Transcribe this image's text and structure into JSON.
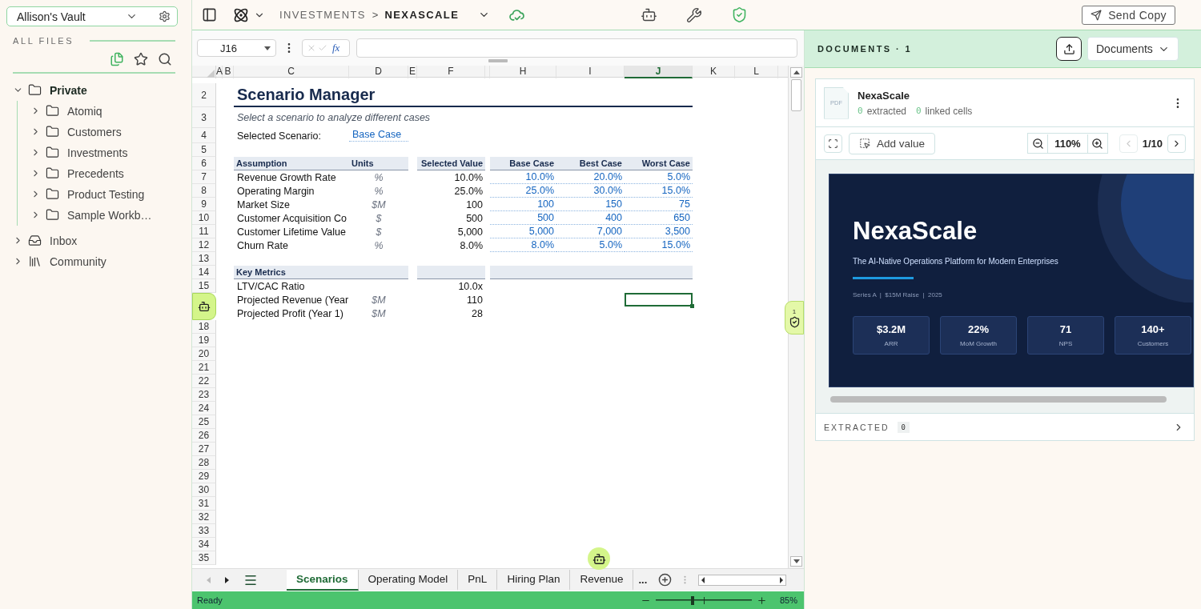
{
  "sidebar": {
    "vault": "Allison's Vault",
    "section_label": "ALL FILES",
    "tree": [
      {
        "label": "Private",
        "kind": "folder",
        "expanded": true,
        "children": [
          {
            "label": "Atomiq",
            "kind": "folder",
            "expanded": false
          },
          {
            "label": "Customers",
            "kind": "folder",
            "expanded": false
          },
          {
            "label": "Investments",
            "kind": "folder",
            "expanded": false
          },
          {
            "label": "Precedents",
            "kind": "folder",
            "expanded": false
          },
          {
            "label": "Product Testing",
            "kind": "folder",
            "expanded": false
          },
          {
            "label": "Sample Workb…",
            "kind": "folder",
            "expanded": false
          }
        ]
      },
      {
        "label": "Inbox",
        "kind": "inbox",
        "expanded": false
      },
      {
        "label": "Community",
        "kind": "library",
        "expanded": false
      }
    ]
  },
  "toolbar": {
    "breadcrumb": [
      {
        "label": "INVESTMENTS",
        "current": false
      },
      {
        "label": "NEXASCALE",
        "current": true
      }
    ],
    "separator": ">",
    "send_button": "Send Copy"
  },
  "sheet": {
    "name_box": "J16",
    "fx": "fx",
    "columns": [
      {
        "label": "A",
        "selected": false
      },
      {
        "label": "B",
        "selected": false
      },
      {
        "label": "C",
        "selected": false
      },
      {
        "label": "D",
        "selected": false
      },
      {
        "label": "E",
        "selected": false
      },
      {
        "label": "F",
        "selected": false
      },
      {
        "selected": false
      },
      {
        "label": "H",
        "selected": false
      },
      {
        "label": "I",
        "selected": false
      },
      {
        "label": "J",
        "selected": true
      },
      {
        "label": "K",
        "selected": false
      },
      {
        "label": "L",
        "selected": false
      }
    ],
    "rows": [
      {
        "n": "2",
        "selected": false,
        "cells": {
          "C": {
            "kind": "title",
            "text": "Scenario Manager"
          }
        }
      },
      {
        "n": "3",
        "selected": false,
        "cells": {
          "C": {
            "kind": "subtitle",
            "text": "Select a scenario to analyze different cases"
          }
        }
      },
      {
        "n": "4",
        "selected": false,
        "cells": {
          "C": {
            "kind": "label",
            "text": "Selected Scenario:"
          },
          "D": {
            "kind": "link",
            "text": "Base Case"
          }
        }
      },
      {
        "n": "5",
        "selected": false
      },
      {
        "n": "6",
        "selected": false,
        "cells": {
          "C": {
            "kind": "header",
            "text": "Assumption"
          },
          "D": {
            "kind": "header",
            "text": "Units"
          },
          "F": {
            "kind": "header_right",
            "text": "Selected Value"
          },
          "H": {
            "kind": "header_right",
            "text": "Base Case"
          },
          "I": {
            "kind": "header_right",
            "text": "Best Case"
          },
          "J": {
            "kind": "header_right",
            "text": "Worst Case"
          }
        }
      },
      {
        "n": "7",
        "selected": false,
        "cells": {
          "C": {
            "kind": "label",
            "text": "Revenue Growth Rate"
          },
          "D": {
            "kind": "unit",
            "text": "%"
          },
          "F": {
            "kind": "value",
            "text": "10.0%"
          },
          "H": {
            "kind": "input",
            "text": "10.0%"
          },
          "I": {
            "kind": "input",
            "text": "20.0%"
          },
          "J": {
            "kind": "input",
            "text": "5.0%"
          }
        }
      },
      {
        "n": "8",
        "selected": false,
        "cells": {
          "C": {
            "kind": "label",
            "text": "Operating Margin"
          },
          "D": {
            "kind": "unit",
            "text": "%"
          },
          "F": {
            "kind": "value",
            "text": "25.0%"
          },
          "H": {
            "kind": "input",
            "text": "25.0%"
          },
          "I": {
            "kind": "input",
            "text": "30.0%"
          },
          "J": {
            "kind": "input",
            "text": "15.0%"
          }
        }
      },
      {
        "n": "9",
        "selected": false,
        "cells": {
          "C": {
            "kind": "label",
            "text": "Market Size"
          },
          "D": {
            "kind": "unit",
            "text": "$M"
          },
          "F": {
            "kind": "value",
            "text": "100"
          },
          "H": {
            "kind": "input",
            "text": "100"
          },
          "I": {
            "kind": "input",
            "text": "150"
          },
          "J": {
            "kind": "input",
            "text": "75"
          }
        }
      },
      {
        "n": "10",
        "selected": false,
        "cells": {
          "C": {
            "kind": "label",
            "text": "Customer Acquisition Co"
          },
          "D": {
            "kind": "unit",
            "text": "$"
          },
          "F": {
            "kind": "value",
            "text": "500"
          },
          "H": {
            "kind": "input",
            "text": "500"
          },
          "I": {
            "kind": "input",
            "text": "400"
          },
          "J": {
            "kind": "input",
            "text": "650"
          }
        }
      },
      {
        "n": "11",
        "selected": false,
        "cells": {
          "C": {
            "kind": "label",
            "text": "Customer Lifetime Value"
          },
          "D": {
            "kind": "unit",
            "text": "$"
          },
          "F": {
            "kind": "value",
            "text": "5,000"
          },
          "H": {
            "kind": "input",
            "text": "5,000"
          },
          "I": {
            "kind": "input",
            "text": "7,000"
          },
          "J": {
            "kind": "input",
            "text": "3,500"
          }
        }
      },
      {
        "n": "12",
        "selected": false,
        "cells": {
          "C": {
            "kind": "label",
            "text": "Churn Rate"
          },
          "D": {
            "kind": "unit",
            "text": "%"
          },
          "F": {
            "kind": "value",
            "text": "8.0%"
          },
          "H": {
            "kind": "input",
            "text": "8.0%"
          },
          "I": {
            "kind": "input",
            "text": "5.0%"
          },
          "J": {
            "kind": "input",
            "text": "15.0%"
          }
        }
      },
      {
        "n": "13",
        "selected": false
      },
      {
        "n": "14",
        "selected": false,
        "cells": {
          "C": {
            "kind": "section",
            "text": "Key Metrics"
          },
          "F": {
            "kind": "band"
          },
          "H": {
            "kind": "band_wide"
          }
        }
      },
      {
        "n": "15",
        "selected": false,
        "cells": {
          "C": {
            "kind": "label",
            "text": "LTV/CAC Ratio"
          },
          "F": {
            "kind": "value",
            "text": "10.0x"
          }
        }
      },
      {
        "selected": true,
        "cells": {
          "C": {
            "kind": "label",
            "text": "Projected Revenue (Year"
          },
          "D": {
            "kind": "unit",
            "text": "$M"
          },
          "F": {
            "kind": "value",
            "text": "110"
          }
        }
      },
      {
        "selected": false,
        "cells": {
          "C": {
            "kind": "label",
            "text": "Projected Profit (Year 1)"
          },
          "D": {
            "kind": "unit",
            "text": "$M"
          },
          "F": {
            "kind": "value",
            "text": "28"
          }
        }
      },
      {
        "n": "18",
        "selected": false
      },
      {
        "n": "19",
        "selected": false
      },
      {
        "n": "20",
        "selected": false
      },
      {
        "n": "21",
        "selected": false
      },
      {
        "n": "22",
        "selected": false
      },
      {
        "n": "23",
        "selected": false
      },
      {
        "n": "24",
        "selected": false
      },
      {
        "n": "25",
        "selected": false
      },
      {
        "n": "26",
        "selected": false
      },
      {
        "n": "27",
        "selected": false
      },
      {
        "n": "28",
        "selected": false
      },
      {
        "n": "29",
        "selected": false
      },
      {
        "n": "30",
        "selected": false
      },
      {
        "n": "31",
        "selected": false
      },
      {
        "n": "32",
        "selected": false
      },
      {
        "n": "33",
        "selected": false
      },
      {
        "n": "34",
        "selected": false
      },
      {
        "n": "35",
        "selected": false
      }
    ],
    "tabs": [
      {
        "label": "Scenarios",
        "selected": true
      },
      {
        "label": "Operating Model",
        "selected": false
      },
      {
        "label": "PnL",
        "selected": false
      },
      {
        "label": "Hiring Plan",
        "selected": false
      },
      {
        "label": "Revenue",
        "selected": false
      }
    ],
    "more_tabs": "...",
    "status": "Ready",
    "zoom": {
      "level": 0.38,
      "reading": "85%"
    },
    "review_count": "1"
  },
  "documents": {
    "title": "DOCUMENTS · 1",
    "dropdown": "Documents",
    "file": {
      "type_label": "PDF",
      "name": "NexaScale",
      "extracted_count": "0",
      "extracted_label": "extracted",
      "linked_count": "0",
      "linked_label": "linked cells"
    },
    "add_value": "Add value",
    "zoom": "110%",
    "pager": {
      "label": "1/10",
      "prev_disabled": true,
      "next_disabled": false
    },
    "slide": {
      "title": "NexaScale",
      "tagline": "The AI-Native Operations Platform for Modern Enterprises",
      "meta": "Series A  |  $15M Raise  |  2025",
      "stats": [
        {
          "value": "$3.2M",
          "label": "ARR"
        },
        {
          "value": "22%",
          "label": "MoM Growth"
        },
        {
          "value": "71",
          "label": "NPS"
        },
        {
          "value": "140+",
          "label": "Customers"
        }
      ]
    },
    "extracted": {
      "label": "EXTRACTED",
      "count": "0"
    }
  }
}
